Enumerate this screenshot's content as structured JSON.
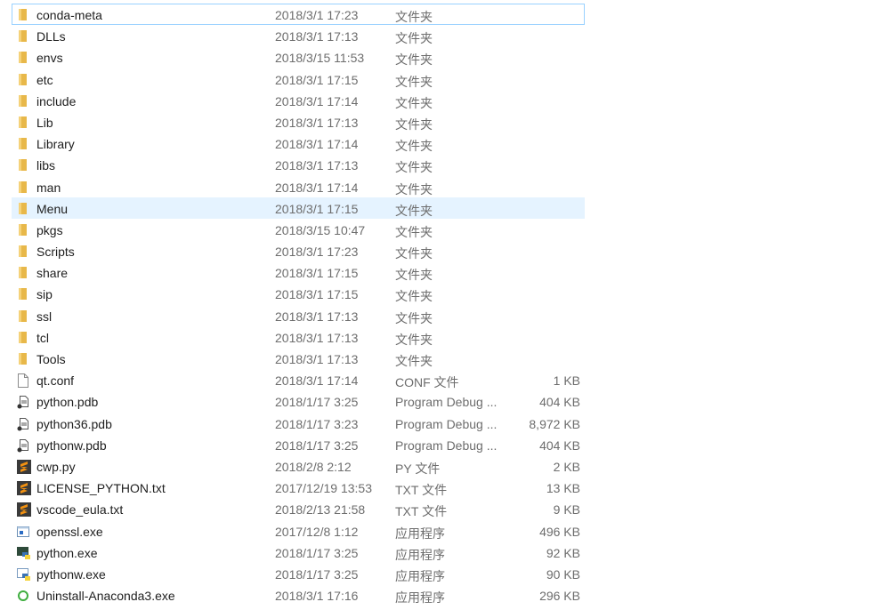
{
  "colors": {
    "folder": "#e8b84a",
    "selection_border": "#99d1ff",
    "hover_bg": "#e5f3ff",
    "sublime_orange": "#f29111"
  },
  "files": [
    {
      "name": "conda-meta",
      "date": "2018/3/1 17:23",
      "type": "文件夹",
      "size": "",
      "icon": "folder-icon",
      "state": "selected"
    },
    {
      "name": "DLLs",
      "date": "2018/3/1 17:13",
      "type": "文件夹",
      "size": "",
      "icon": "folder-icon"
    },
    {
      "name": "envs",
      "date": "2018/3/15 11:53",
      "type": "文件夹",
      "size": "",
      "icon": "folder-icon"
    },
    {
      "name": "etc",
      "date": "2018/3/1 17:15",
      "type": "文件夹",
      "size": "",
      "icon": "folder-icon"
    },
    {
      "name": "include",
      "date": "2018/3/1 17:14",
      "type": "文件夹",
      "size": "",
      "icon": "folder-icon"
    },
    {
      "name": "Lib",
      "date": "2018/3/1 17:13",
      "type": "文件夹",
      "size": "",
      "icon": "folder-icon"
    },
    {
      "name": "Library",
      "date": "2018/3/1 17:14",
      "type": "文件夹",
      "size": "",
      "icon": "folder-icon"
    },
    {
      "name": "libs",
      "date": "2018/3/1 17:13",
      "type": "文件夹",
      "size": "",
      "icon": "folder-icon"
    },
    {
      "name": "man",
      "date": "2018/3/1 17:14",
      "type": "文件夹",
      "size": "",
      "icon": "folder-icon"
    },
    {
      "name": "Menu",
      "date": "2018/3/1 17:15",
      "type": "文件夹",
      "size": "",
      "icon": "folder-icon",
      "state": "hover"
    },
    {
      "name": "pkgs",
      "date": "2018/3/15 10:47",
      "type": "文件夹",
      "size": "",
      "icon": "folder-icon"
    },
    {
      "name": "Scripts",
      "date": "2018/3/1 17:23",
      "type": "文件夹",
      "size": "",
      "icon": "folder-icon"
    },
    {
      "name": "share",
      "date": "2018/3/1 17:15",
      "type": "文件夹",
      "size": "",
      "icon": "folder-icon"
    },
    {
      "name": "sip",
      "date": "2018/3/1 17:15",
      "type": "文件夹",
      "size": "",
      "icon": "folder-icon"
    },
    {
      "name": "ssl",
      "date": "2018/3/1 17:13",
      "type": "文件夹",
      "size": "",
      "icon": "folder-icon"
    },
    {
      "name": "tcl",
      "date": "2018/3/1 17:13",
      "type": "文件夹",
      "size": "",
      "icon": "folder-icon"
    },
    {
      "name": "Tools",
      "date": "2018/3/1 17:13",
      "type": "文件夹",
      "size": "",
      "icon": "folder-icon"
    },
    {
      "name": "qt.conf",
      "date": "2018/3/1 17:14",
      "type": "CONF 文件",
      "size": "1 KB",
      "icon": "blank-file-icon"
    },
    {
      "name": "python.pdb",
      "date": "2018/1/17 3:25",
      "type": "Program Debug ...",
      "size": "404 KB",
      "icon": "debug-file-icon"
    },
    {
      "name": "python36.pdb",
      "date": "2018/1/17 3:23",
      "type": "Program Debug ...",
      "size": "8,972 KB",
      "icon": "debug-file-icon"
    },
    {
      "name": "pythonw.pdb",
      "date": "2018/1/17 3:25",
      "type": "Program Debug ...",
      "size": "404 KB",
      "icon": "debug-file-icon"
    },
    {
      "name": "cwp.py",
      "date": "2018/2/8 2:12",
      "type": "PY 文件",
      "size": "2 KB",
      "icon": "sublime-text-icon"
    },
    {
      "name": "LICENSE_PYTHON.txt",
      "date": "2017/12/19 13:53",
      "type": "TXT 文件",
      "size": "13 KB",
      "icon": "sublime-text-icon"
    },
    {
      "name": "vscode_eula.txt",
      "date": "2018/2/13 21:58",
      "type": "TXT 文件",
      "size": "9 KB",
      "icon": "sublime-text-icon"
    },
    {
      "name": "openssl.exe",
      "date": "2017/12/8 1:12",
      "type": "应用程序",
      "size": "496 KB",
      "icon": "application-icon"
    },
    {
      "name": "python.exe",
      "date": "2018/1/17 3:25",
      "type": "应用程序",
      "size": "92 KB",
      "icon": "python-exe-icon"
    },
    {
      "name": "pythonw.exe",
      "date": "2018/1/17 3:25",
      "type": "应用程序",
      "size": "90 KB",
      "icon": "pythonw-exe-icon"
    },
    {
      "name": "Uninstall-Anaconda3.exe",
      "date": "2018/3/1 17:16",
      "type": "应用程序",
      "size": "296 KB",
      "icon": "anaconda-icon"
    }
  ]
}
